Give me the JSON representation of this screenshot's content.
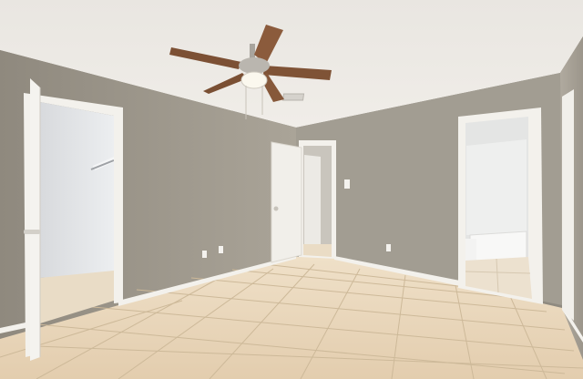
{
  "scene": {
    "description_visible_text": "",
    "palette": {
      "ceiling": "#ece9e4",
      "wall_left": "#a7a195",
      "wall_back": "#9f9a8f",
      "wall_right": "#aaa398",
      "tile": "#e6d2b6",
      "grout": "#cbb89c",
      "trim": "#f3f1ec",
      "door": "#f1efea",
      "fan_blade": "#8a5a3c",
      "fan_metal": "#b9b5ae"
    }
  }
}
